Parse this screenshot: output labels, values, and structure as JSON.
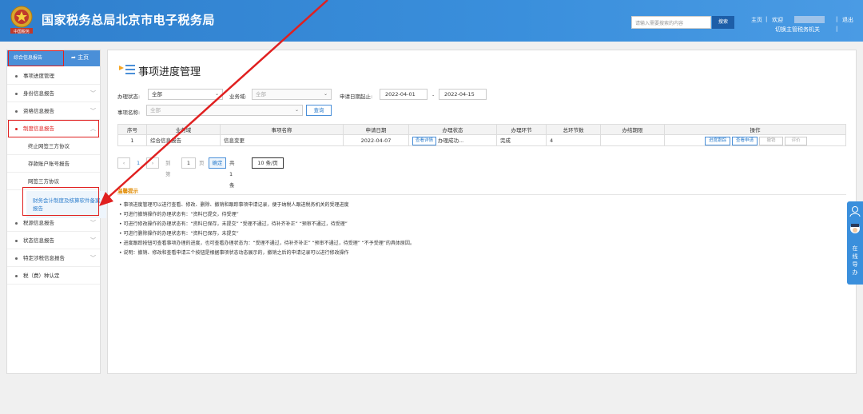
{
  "header": {
    "title": "国家税务总局北京市电子税务局",
    "search_placeholder": "请输入需要搜索的内容",
    "search_button": "搜索",
    "home_link": "主页",
    "welcome": "欢迎",
    "logout": "退出",
    "switch_org": "切换主管税务机关",
    "emblem_text": "中国税务"
  },
  "sidebar": {
    "head_label": "综合信息报告",
    "home_label": "主页",
    "items": [
      {
        "label": "事项进度管理"
      },
      {
        "label": "身份信息报告"
      },
      {
        "label": "资格信息报告"
      },
      {
        "label": "制度信息报告"
      },
      {
        "label": "终止网签三方协议"
      },
      {
        "label": "存款账户账号报告"
      },
      {
        "label": "网签三方协议"
      },
      {
        "label": "财务会计制度及核算软件备案报告"
      },
      {
        "label": "税源信息报告"
      },
      {
        "label": "状态信息报告"
      },
      {
        "label": "特定涉税信息报告"
      },
      {
        "label": "税（费）种认定"
      }
    ]
  },
  "main": {
    "title": "事项进度管理",
    "filters": {
      "status_label": "办理状态:",
      "status_value": "全部",
      "domain_label": "业务域:",
      "domain_value": "全部",
      "date_label": "申请日期起止:",
      "date_from": "2022-04-01",
      "date_sep": "-",
      "date_to": "2022-04-15",
      "name_label": "事项名称:",
      "name_value": "全部",
      "query_button": "查询"
    },
    "table": {
      "headers": [
        "序号",
        "业务域",
        "事项名称",
        "申请日期",
        "办理状态",
        "办理环节",
        "总环节数",
        "办结期限",
        "操作"
      ],
      "rows": [
        {
          "index": "1",
          "domain": "综合信息报告",
          "name": "信息变更",
          "date": "2022-04-07",
          "status_btn": "查看详情",
          "status": "办理成功...",
          "step": "完成",
          "total_steps": "4",
          "deadline": "",
          "actions": [
            "进度跟踪",
            "查看申请",
            "撤销",
            "评价"
          ]
        }
      ]
    },
    "pager": {
      "page": "1",
      "goto_label": "到第",
      "goto_value": "1",
      "page_unit": "页",
      "confirm": "确定",
      "total": "共 1 条",
      "per_page": "10 条/页"
    },
    "tips": {
      "title": "温馨提示",
      "lines": [
        "事项进度管理可以进行查看、修改、删除、撤销和跟踪事项申请记录，便于纳税人跟进税务机关的受理进度",
        "可进行撤销操作的办理状态有：“资料已提交，待受理”",
        "可进行修改操作的办理状态有：“资料已保存，未提交” “受理不通过，待补齐补正” “预审不通过，待受理”",
        "可进行删除操作的办理状态有：“资料已保存，未提交”",
        "进度跟踪按钮可查看事项办理的进度，也可查看办理状态为：“受理不通过，待补齐补正” “预审不通过，待受理” “不予受理”的具体原因。",
        "说明：撤销、修改和查看申请三个按钮是根据事项状态动态展示的，撤销之后的申请记录可以进行修改操作"
      ]
    }
  },
  "float_tab": {
    "label": "在线导办"
  },
  "colors": {
    "header_bg": "#2f7fcd",
    "accent": "#2f7fcd",
    "highlight_red": "#e02020",
    "tip_title": "#e08a00"
  }
}
